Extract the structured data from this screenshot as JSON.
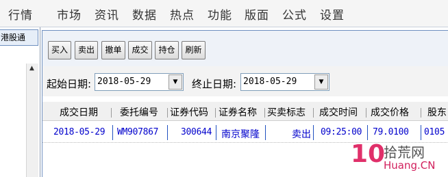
{
  "menu": {
    "items": [
      "行情",
      "市场",
      "资讯",
      "数据",
      "热点",
      "功能",
      "版面",
      "公式",
      "设置"
    ]
  },
  "left_panel": {
    "tab_label": "港股通"
  },
  "toolbar": {
    "buttons": [
      "买入",
      "卖出",
      "撤单",
      "成交",
      "持仓",
      "刷新"
    ]
  },
  "date_filter": {
    "start_label": "起始日期:",
    "start_value": "2018-05-29",
    "end_label": "终止日期:",
    "end_value": "2018-05-29"
  },
  "table": {
    "columns": [
      "成交日期",
      "委托编号",
      "证券代码",
      "证券名称",
      "买卖标志",
      "成交时间",
      "成交价格",
      "股东"
    ],
    "rows": [
      [
        "2018-05-29",
        "WM907867",
        "300644",
        "南京聚隆",
        "卖出",
        "09:25:00",
        "79.0100",
        "0105"
      ]
    ]
  },
  "watermark": {
    "number": "10",
    "site_cn": "拾荒网",
    "site_en": "Huang.CN"
  },
  "colors": {
    "row_text": "#0000cc",
    "watermark": "#e0306a"
  }
}
